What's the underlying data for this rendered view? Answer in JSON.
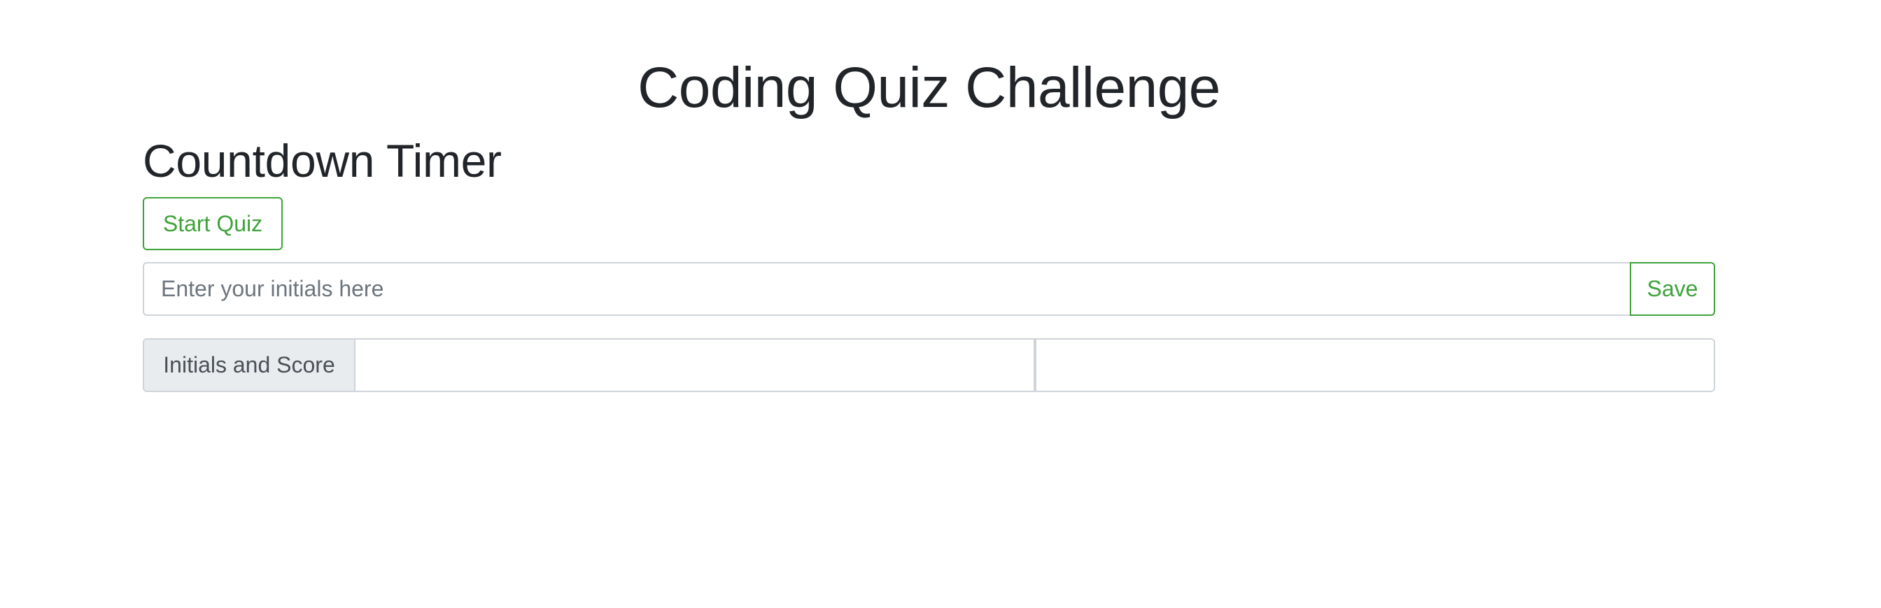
{
  "header": {
    "title": "Coding Quiz Challenge"
  },
  "timer": {
    "heading": "Countdown Timer"
  },
  "quiz": {
    "start_label": "Start Quiz"
  },
  "initials": {
    "placeholder": "Enter your initials here",
    "value": "",
    "save_label": "Save"
  },
  "scores": {
    "label": "Initials and Score",
    "cell_1": "",
    "cell_2": ""
  },
  "colors": {
    "accent": "#3fa33a",
    "text": "#212529",
    "border": "#ced4da",
    "label_bg": "#e9ecef"
  }
}
